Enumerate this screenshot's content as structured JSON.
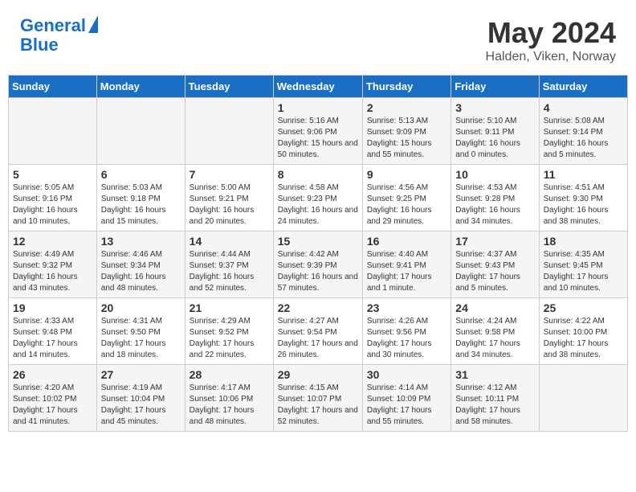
{
  "header": {
    "logo_line1": "General",
    "logo_line2": "Blue",
    "title": "May 2024",
    "subtitle": "Halden, Viken, Norway"
  },
  "days_of_week": [
    "Sunday",
    "Monday",
    "Tuesday",
    "Wednesday",
    "Thursday",
    "Friday",
    "Saturday"
  ],
  "weeks": [
    [
      {
        "day": "",
        "info": ""
      },
      {
        "day": "",
        "info": ""
      },
      {
        "day": "",
        "info": ""
      },
      {
        "day": "1",
        "info": "Sunrise: 5:16 AM\nSunset: 9:06 PM\nDaylight: 15 hours and 50 minutes."
      },
      {
        "day": "2",
        "info": "Sunrise: 5:13 AM\nSunset: 9:09 PM\nDaylight: 15 hours and 55 minutes."
      },
      {
        "day": "3",
        "info": "Sunrise: 5:10 AM\nSunset: 9:11 PM\nDaylight: 16 hours and 0 minutes."
      },
      {
        "day": "4",
        "info": "Sunrise: 5:08 AM\nSunset: 9:14 PM\nDaylight: 16 hours and 5 minutes."
      }
    ],
    [
      {
        "day": "5",
        "info": "Sunrise: 5:05 AM\nSunset: 9:16 PM\nDaylight: 16 hours and 10 minutes."
      },
      {
        "day": "6",
        "info": "Sunrise: 5:03 AM\nSunset: 9:18 PM\nDaylight: 16 hours and 15 minutes."
      },
      {
        "day": "7",
        "info": "Sunrise: 5:00 AM\nSunset: 9:21 PM\nDaylight: 16 hours and 20 minutes."
      },
      {
        "day": "8",
        "info": "Sunrise: 4:58 AM\nSunset: 9:23 PM\nDaylight: 16 hours and 24 minutes."
      },
      {
        "day": "9",
        "info": "Sunrise: 4:56 AM\nSunset: 9:25 PM\nDaylight: 16 hours and 29 minutes."
      },
      {
        "day": "10",
        "info": "Sunrise: 4:53 AM\nSunset: 9:28 PM\nDaylight: 16 hours and 34 minutes."
      },
      {
        "day": "11",
        "info": "Sunrise: 4:51 AM\nSunset: 9:30 PM\nDaylight: 16 hours and 38 minutes."
      }
    ],
    [
      {
        "day": "12",
        "info": "Sunrise: 4:49 AM\nSunset: 9:32 PM\nDaylight: 16 hours and 43 minutes."
      },
      {
        "day": "13",
        "info": "Sunrise: 4:46 AM\nSunset: 9:34 PM\nDaylight: 16 hours and 48 minutes."
      },
      {
        "day": "14",
        "info": "Sunrise: 4:44 AM\nSunset: 9:37 PM\nDaylight: 16 hours and 52 minutes."
      },
      {
        "day": "15",
        "info": "Sunrise: 4:42 AM\nSunset: 9:39 PM\nDaylight: 16 hours and 57 minutes."
      },
      {
        "day": "16",
        "info": "Sunrise: 4:40 AM\nSunset: 9:41 PM\nDaylight: 17 hours and 1 minute."
      },
      {
        "day": "17",
        "info": "Sunrise: 4:37 AM\nSunset: 9:43 PM\nDaylight: 17 hours and 5 minutes."
      },
      {
        "day": "18",
        "info": "Sunrise: 4:35 AM\nSunset: 9:45 PM\nDaylight: 17 hours and 10 minutes."
      }
    ],
    [
      {
        "day": "19",
        "info": "Sunrise: 4:33 AM\nSunset: 9:48 PM\nDaylight: 17 hours and 14 minutes."
      },
      {
        "day": "20",
        "info": "Sunrise: 4:31 AM\nSunset: 9:50 PM\nDaylight: 17 hours and 18 minutes."
      },
      {
        "day": "21",
        "info": "Sunrise: 4:29 AM\nSunset: 9:52 PM\nDaylight: 17 hours and 22 minutes."
      },
      {
        "day": "22",
        "info": "Sunrise: 4:27 AM\nSunset: 9:54 PM\nDaylight: 17 hours and 26 minutes."
      },
      {
        "day": "23",
        "info": "Sunrise: 4:26 AM\nSunset: 9:56 PM\nDaylight: 17 hours and 30 minutes."
      },
      {
        "day": "24",
        "info": "Sunrise: 4:24 AM\nSunset: 9:58 PM\nDaylight: 17 hours and 34 minutes."
      },
      {
        "day": "25",
        "info": "Sunrise: 4:22 AM\nSunset: 10:00 PM\nDaylight: 17 hours and 38 minutes."
      }
    ],
    [
      {
        "day": "26",
        "info": "Sunrise: 4:20 AM\nSunset: 10:02 PM\nDaylight: 17 hours and 41 minutes."
      },
      {
        "day": "27",
        "info": "Sunrise: 4:19 AM\nSunset: 10:04 PM\nDaylight: 17 hours and 45 minutes."
      },
      {
        "day": "28",
        "info": "Sunrise: 4:17 AM\nSunset: 10:06 PM\nDaylight: 17 hours and 48 minutes."
      },
      {
        "day": "29",
        "info": "Sunrise: 4:15 AM\nSunset: 10:07 PM\nDaylight: 17 hours and 52 minutes."
      },
      {
        "day": "30",
        "info": "Sunrise: 4:14 AM\nSunset: 10:09 PM\nDaylight: 17 hours and 55 minutes."
      },
      {
        "day": "31",
        "info": "Sunrise: 4:12 AM\nSunset: 10:11 PM\nDaylight: 17 hours and 58 minutes."
      },
      {
        "day": "",
        "info": ""
      }
    ]
  ]
}
